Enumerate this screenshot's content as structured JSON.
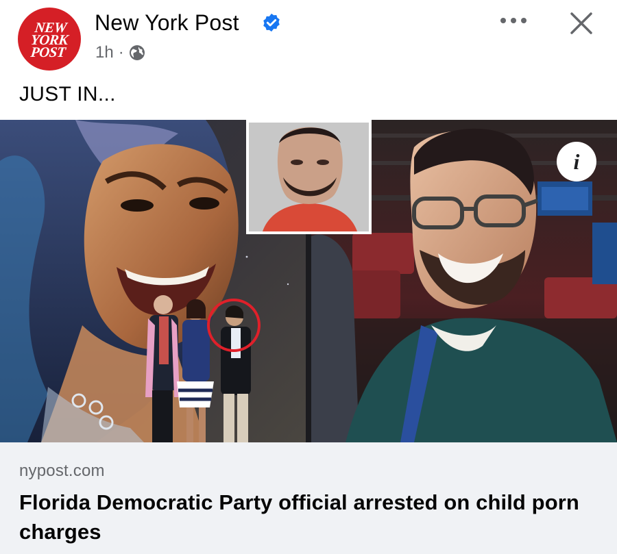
{
  "post": {
    "page_name": "New York Post",
    "avatar_text": "NEW\nYORK\nPOST",
    "time": "1h",
    "separator": "·",
    "text": "JUST IN..."
  },
  "icons": {
    "verified": "verified-badge-icon",
    "privacy": "globe-icon",
    "more": "more-options-icon",
    "close": "close-icon",
    "info": "info-icon"
  },
  "link_preview": {
    "domain": "nypost.com",
    "title": "Florida Democratic Party official arrested on child porn charges"
  },
  "colors": {
    "brand_red": "#d51f26",
    "verified_blue": "#1877f2",
    "secondary_text": "#65676b",
    "preview_bg": "#f0f2f5",
    "highlight_circle": "#e0202a"
  }
}
